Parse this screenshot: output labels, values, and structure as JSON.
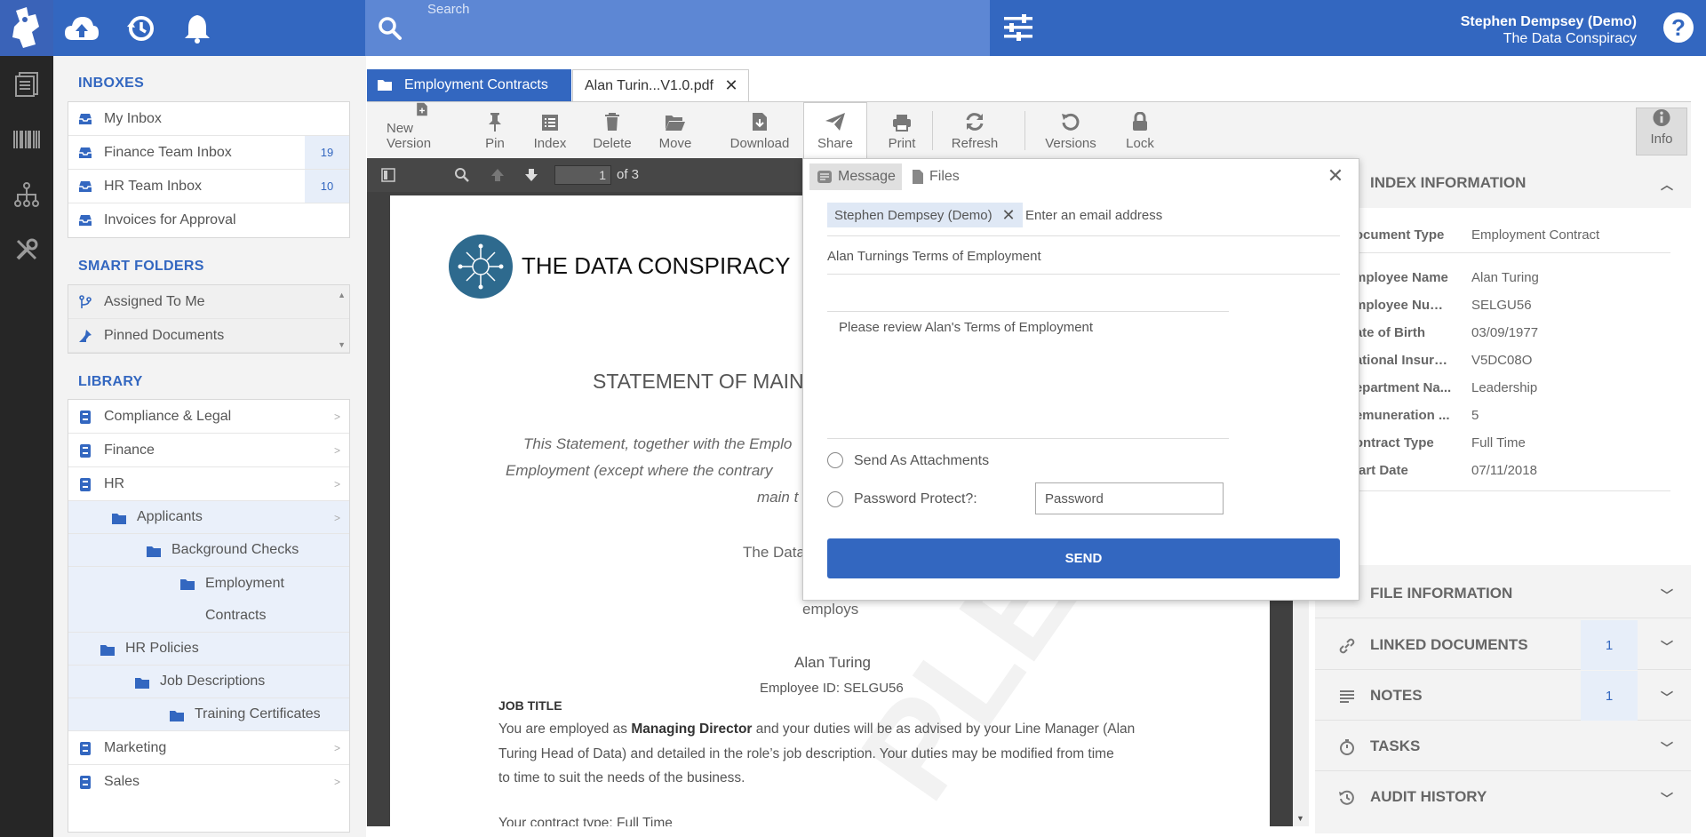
{
  "header": {
    "search_placeholder": "Search",
    "user_name": "Stephen Dempsey (Demo)",
    "org_name": "The Data Conspiracy",
    "help_glyph": "?"
  },
  "sidebar": {
    "inboxes_title": "INBOXES",
    "inboxes": [
      {
        "label": "My Inbox",
        "count": ""
      },
      {
        "label": "Finance Team Inbox",
        "count": "19"
      },
      {
        "label": "HR Team Inbox",
        "count": "10"
      },
      {
        "label": "Invoices for Approval",
        "count": ""
      }
    ],
    "smart_title": "SMART FOLDERS",
    "smart": [
      {
        "label": "Assigned To Me"
      },
      {
        "label": "Pinned Documents"
      }
    ],
    "library_title": "LIBRARY",
    "library": [
      {
        "label": "Compliance & Legal"
      },
      {
        "label": "Finance"
      },
      {
        "label": "HR"
      },
      {
        "label": "Applicants"
      },
      {
        "label": "Background Checks"
      },
      {
        "label": "Employment"
      },
      {
        "label": "Contracts"
      },
      {
        "label": "HR Policies"
      },
      {
        "label": "Job Descriptions"
      },
      {
        "label": "Training Certificates"
      },
      {
        "label": "Marketing"
      },
      {
        "label": "Sales"
      }
    ]
  },
  "tabs": {
    "folder_tab": "Employment Contracts",
    "file_tab": "Alan Turin...V1.0.pdf"
  },
  "toolbar": {
    "new_version": "New Version",
    "pin": "Pin",
    "index": "Index",
    "delete": "Delete",
    "move": "Move",
    "download": "Download",
    "share": "Share",
    "print": "Print",
    "refresh": "Refresh",
    "versions": "Versions",
    "lock": "Lock",
    "info": "Info"
  },
  "viewer": {
    "page_number": "1",
    "page_of": "of 3"
  },
  "document": {
    "company": "THE DATA CONSPIRACY",
    "heading": "STATEMENT OF MAIN",
    "intro_line1": "This Statement, together with the Emplo",
    "intro_line2": "Employment (except where the contrary",
    "intro_line3": "main t",
    "the_data": "The Data",
    "employs": "employs",
    "employee_name": "Alan Turing",
    "employee_id": "Employee ID: SELGU56",
    "job_title_heading": "JOB TITLE",
    "body_1a": "You are employed as ",
    "body_1b": "Managing Director",
    "body_1c": " and your duties will be as advised by your Line Manager (Alan",
    "body_2": "Turing Head of Data) and detailed in the role’s job description. Your duties may be modified from time",
    "body_3": "to time to suit the needs of the business.",
    "body_4": "Your contract type: Full Time"
  },
  "share": {
    "tab_message": "Message",
    "tab_files": "Files",
    "chip": "Stephen Dempsey (Demo)",
    "email_placeholder": "Enter an email address",
    "subject": "Alan Turnings Terms of Employment",
    "message": "Please review Alan's Terms of Employment",
    "send_as_attachments": "Send As Attachments",
    "password_protect": "Password Protect?:",
    "password_placeholder": "Password",
    "send": "SEND"
  },
  "right_panel": {
    "index_title": "INDEX INFORMATION",
    "fields": [
      {
        "k": "Document Type",
        "v": "Employment Contract"
      },
      {
        "k": "Employee Name",
        "v": "Alan Turing"
      },
      {
        "k": "Employee Num...",
        "v": "SELGU56"
      },
      {
        "k": "Date of Birth",
        "v": "03/09/1977"
      },
      {
        "k": "National Insura...",
        "v": "V5DC08O"
      },
      {
        "k": "Department Na...",
        "v": "Leadership"
      },
      {
        "k": "Remuneration ...",
        "v": "5"
      },
      {
        "k": "Contract Type",
        "v": "Full Time"
      },
      {
        "k": "Start Date",
        "v": "07/11/2018"
      }
    ],
    "file_info": "FILE INFORMATION",
    "linked": "LINKED DOCUMENTS",
    "linked_count": "1",
    "notes": "NOTES",
    "notes_count": "1",
    "tasks": "TASKS",
    "audit": "AUDIT HISTORY"
  }
}
